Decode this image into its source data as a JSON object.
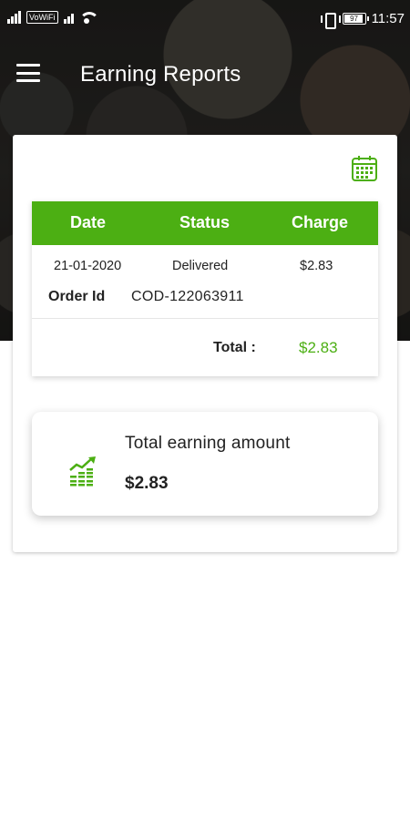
{
  "status_bar": {
    "vowifi": "VoWiFi",
    "battery": "97",
    "time": "11:57"
  },
  "header": {
    "title": "Earning Reports"
  },
  "table": {
    "columns": [
      "Date",
      "Status",
      "Charge"
    ],
    "rows": [
      {
        "date": "21-01-2020",
        "status": "Delivered",
        "charge": "$2.83",
        "order_id_label": "Order Id",
        "order_id": "COD-122063911"
      }
    ],
    "total_label": "Total :",
    "total_value": "$2.83"
  },
  "summary": {
    "label": "Total earning amount",
    "value": "$2.83"
  },
  "colors": {
    "accent": "#4caf13"
  }
}
